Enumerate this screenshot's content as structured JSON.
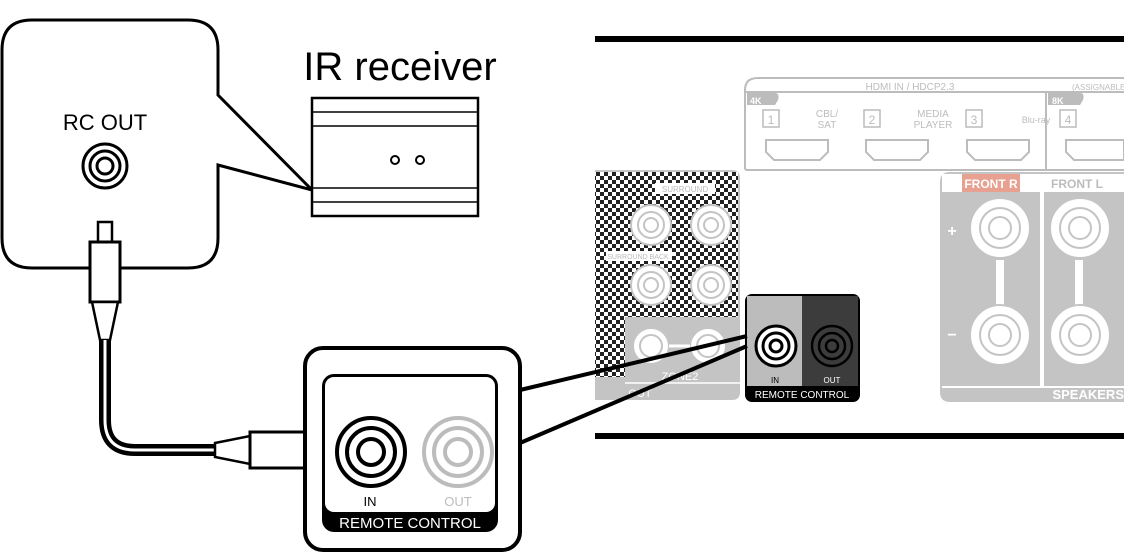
{
  "device_box": {
    "jack_label": "RC OUT"
  },
  "ir_receiver": {
    "title": "IR receiver"
  },
  "zoom_panel": {
    "in_label": "IN",
    "out_label": "OUT",
    "group_label": "REMOTE CONTROL"
  },
  "rear_panel": {
    "hdmi_title": "HDMI IN / HDCP2.3",
    "hdmi_assignable": "(ASSIGNABLE)",
    "hdmi_4k": "4K",
    "hdmi_8k": "8K",
    "hdmi_inputs": [
      {
        "num": "1",
        "name_line1": "CBL/",
        "name_line2": "SAT"
      },
      {
        "num": "2",
        "name_line1": "MEDIA",
        "name_line2": "PLAYER"
      },
      {
        "num": "3",
        "name_line1": "",
        "name_line2": "Blu-ray"
      },
      {
        "num": "4",
        "name_line1": "",
        "name_line2": ""
      }
    ],
    "surround": "SURROUND",
    "surround_back": "SURROUND BACK",
    "zone2": "ZONE2",
    "out_partial": "OUT",
    "rc_in": "IN",
    "rc_out": "OUT",
    "rc_label": "REMOTE CONTROL",
    "front_r": "FRONT R",
    "front_l": "FRONT L",
    "speakers": "SPEAKERS",
    "plus": "+",
    "minus": "−"
  },
  "colors": {
    "front_r_accent": "#e8a090",
    "panel_gray": "#c4c4c4",
    "line_gray": "#bcbcbc"
  }
}
